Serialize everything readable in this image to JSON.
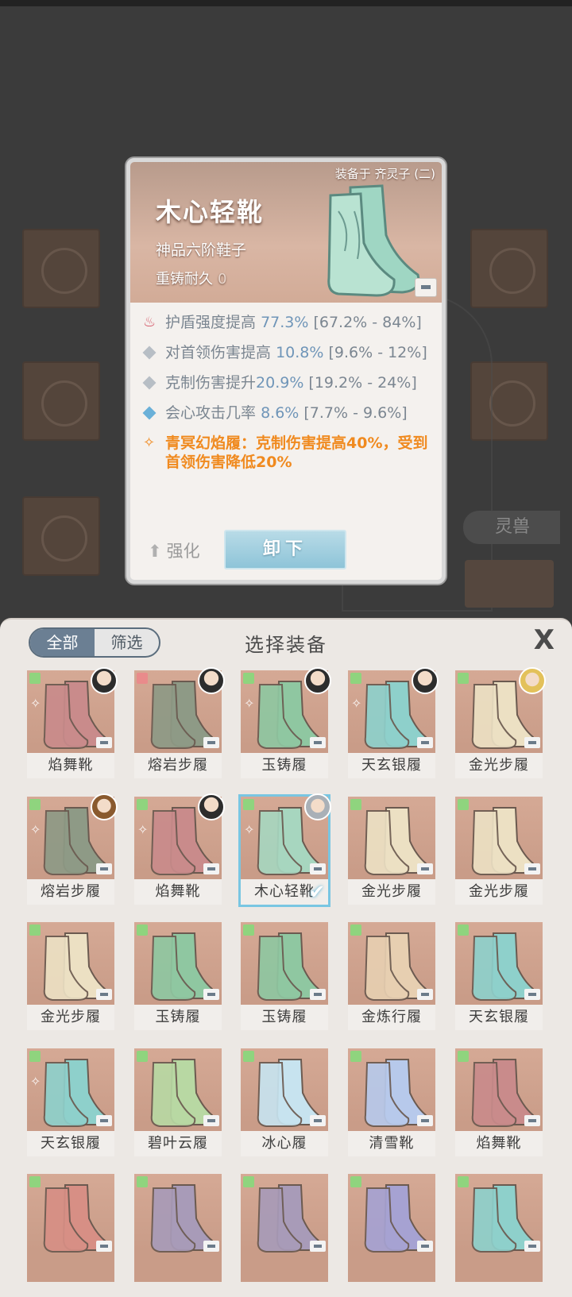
{
  "popup": {
    "equipped_label": "装备于 齐灵子 (二)",
    "item_name": "木心轻靴",
    "grade": "神品六阶鞋子",
    "recast_label": "重铸耐久",
    "recast_value": "0",
    "stats": [
      {
        "name": "护盾强度提高",
        "value": "77.3%",
        "range": "[67.2% - 84%]",
        "icon": "fire-icon"
      },
      {
        "name": "对首领伤害提高",
        "value": "10.8%",
        "range": "[9.6% - 12%]",
        "icon": "diamond-icon"
      },
      {
        "name": "克制伤害提升",
        "value": "20.9%",
        "range": "[19.2% - 24%]",
        "icon": "diamond-icon"
      },
      {
        "name": "会心攻击几率",
        "value": "8.6%",
        "range": "[7.7% - 9.6%]",
        "icon": "blue-diamond-icon"
      }
    ],
    "set_effect": "青冥幻焰履：克制伤害提高40%，受到首领伤害降低20%",
    "upgrade_label": "强化",
    "unequip_label": "卸下"
  },
  "background": {
    "lingshou_label": "灵兽"
  },
  "panel": {
    "tabs": [
      "全部",
      "筛选"
    ],
    "title": "选择装备",
    "close_label": "X",
    "items": [
      {
        "name": "焰舞靴",
        "color": "#c98b8b",
        "avatar": "dark",
        "set": true,
        "icon": "green"
      },
      {
        "name": "熔岩步履",
        "color": "#8e9a86",
        "avatar": "dark",
        "set": false,
        "icon": "red"
      },
      {
        "name": "玉铸履",
        "color": "#8fc7a1",
        "avatar": "dark",
        "set": true,
        "icon": "green"
      },
      {
        "name": "天玄银履",
        "color": "#8ed0cb",
        "avatar": "dark",
        "set": true,
        "icon": "green"
      },
      {
        "name": "金光步履",
        "color": "#ece0c3",
        "avatar": "blond",
        "set": false,
        "icon": "green"
      },
      {
        "name": "熔岩步履",
        "color": "#8e9a86",
        "avatar": "brown",
        "set": true,
        "icon": "green"
      },
      {
        "name": "焰舞靴",
        "color": "#c98b8b",
        "avatar": "dark",
        "set": true,
        "icon": "green"
      },
      {
        "name": "木心轻靴",
        "color": "#a7d6bf",
        "avatar": "grey",
        "set": true,
        "icon": "green",
        "selected": true
      },
      {
        "name": "金光步履",
        "color": "#ece0c3",
        "avatar": "",
        "set": false,
        "icon": "green"
      },
      {
        "name": "金光步履",
        "color": "#ece0c3",
        "avatar": "",
        "set": false,
        "icon": "green"
      },
      {
        "name": "金光步履",
        "color": "#ece0c3",
        "avatar": "",
        "set": false,
        "icon": "green"
      },
      {
        "name": "玉铸履",
        "color": "#8fc7a1",
        "avatar": "",
        "set": false,
        "icon": "green"
      },
      {
        "name": "玉铸履",
        "color": "#8fc7a1",
        "avatar": "",
        "set": false,
        "icon": "green"
      },
      {
        "name": "金炼行履",
        "color": "#e7cfb1",
        "avatar": "",
        "set": false,
        "icon": "green"
      },
      {
        "name": "天玄银履",
        "color": "#8ed0cb",
        "avatar": "",
        "set": false,
        "icon": "green"
      },
      {
        "name": "天玄银履",
        "color": "#8ed0cb",
        "avatar": "",
        "set": true,
        "icon": "green"
      },
      {
        "name": "碧叶云履",
        "color": "#b8d8a3",
        "avatar": "",
        "set": false,
        "icon": "green"
      },
      {
        "name": "冰心履",
        "color": "#c7e3ef",
        "avatar": "",
        "set": false,
        "icon": "green"
      },
      {
        "name": "清雪靴",
        "color": "#b7c9eb",
        "avatar": "",
        "set": false,
        "icon": "green"
      },
      {
        "name": "焰舞靴",
        "color": "#c98b8b",
        "avatar": "",
        "set": false,
        "icon": "green"
      },
      {
        "name": "",
        "color": "#d78f85",
        "avatar": "",
        "set": false,
        "icon": "green"
      },
      {
        "name": "",
        "color": "#a89bb8",
        "avatar": "",
        "set": false,
        "icon": "green"
      },
      {
        "name": "",
        "color": "#a89bb8",
        "avatar": "",
        "set": false,
        "icon": "green"
      },
      {
        "name": "",
        "color": "#a6a2d2",
        "avatar": "",
        "set": false,
        "icon": "green"
      },
      {
        "name": "",
        "color": "#8ed0cb",
        "avatar": "",
        "set": false,
        "icon": "green"
      }
    ]
  }
}
